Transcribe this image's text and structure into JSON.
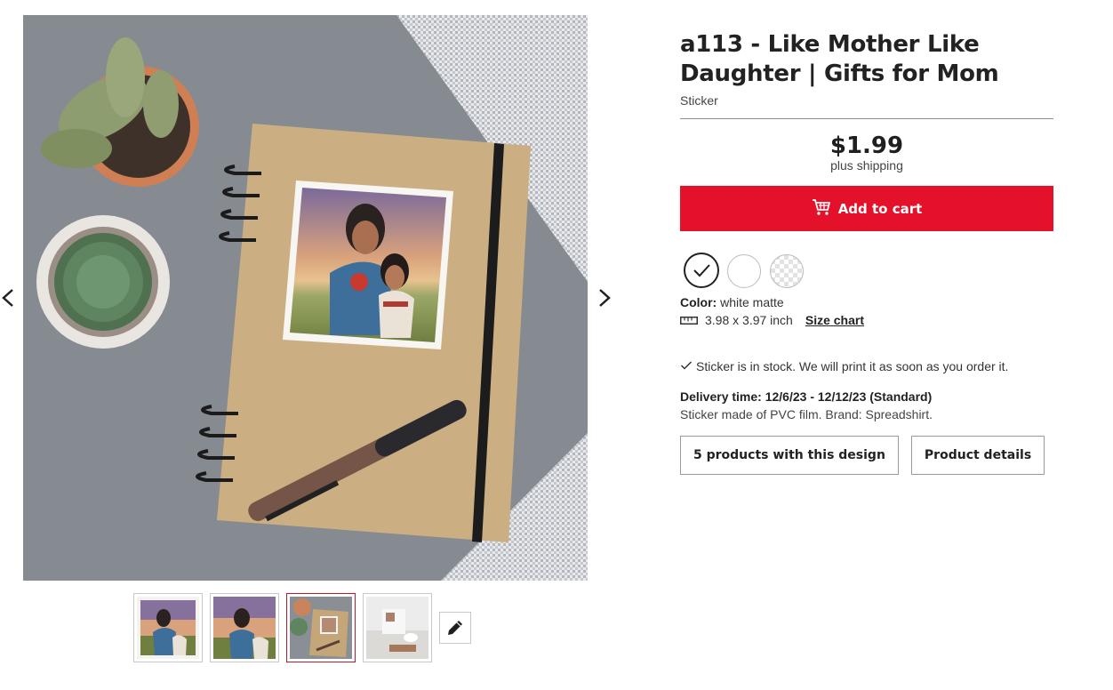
{
  "product": {
    "title": "a113 - Like Mother Like Daughter | Gifts for Mom",
    "type": "Sticker",
    "price": "$1.99",
    "shipping_note": "plus shipping",
    "add_to_cart_label": "Add to cart",
    "color_label": "Color:",
    "color_value": "white matte",
    "size_value": "3.98 x 3.97 inch",
    "size_chart_label": "Size chart",
    "stock_text": "Sticker is in stock. We will print it as soon as you order it.",
    "delivery_label": "Delivery time:",
    "delivery_value": "12/6/23 - 12/12/23 (Standard)",
    "material_text": "Sticker made of PVC film. Brand: Spreadshirt.",
    "buttons": {
      "products_with_design": "5 products with this design",
      "product_details": "Product details"
    },
    "swatches": [
      {
        "name": "white matte",
        "selected": true
      },
      {
        "name": "white",
        "selected": false
      },
      {
        "name": "transparent",
        "selected": false
      }
    ]
  },
  "gallery": {
    "active_thumbnail": 3,
    "thumbnails": [
      "sticker-front",
      "sticker-front-alt",
      "notebook-scene",
      "bedroom-scene"
    ]
  },
  "colors": {
    "accent": "#e4112b",
    "active_thumb_border": "#b81c2a"
  },
  "icons": [
    "chevron-left-icon",
    "chevron-right-icon",
    "cart-icon",
    "check-icon",
    "ruler-icon",
    "pencil-icon"
  ]
}
